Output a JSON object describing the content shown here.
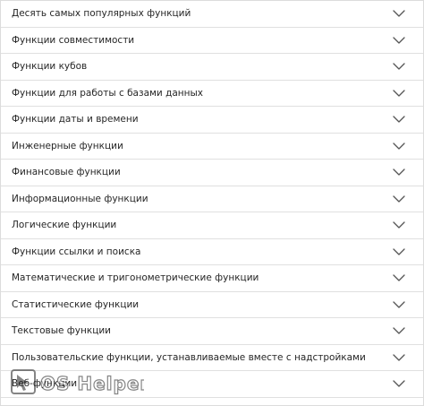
{
  "accordion": {
    "items": [
      {
        "label": "Десять самых популярных функций"
      },
      {
        "label": "Функции совместимости"
      },
      {
        "label": "Функции кубов"
      },
      {
        "label": "Функции для работы с базами данных"
      },
      {
        "label": "Функции даты и времени"
      },
      {
        "label": "Инженерные функции"
      },
      {
        "label": "Финансовые функции"
      },
      {
        "label": "Информационные функции"
      },
      {
        "label": "Логические функции"
      },
      {
        "label": "Функции ссылки и поиска"
      },
      {
        "label": "Математические и тригонометрические функции"
      },
      {
        "label": "Статистические функции"
      },
      {
        "label": "Текстовые функции"
      },
      {
        "label": "Пользовательские функции, устанавливаемые вместе с надстройками"
      },
      {
        "label": "Веб-функции"
      }
    ],
    "expand_icon": "chevron-down-icon"
  },
  "watermark": {
    "text": "OS Helper",
    "icon": "cursor-arrow-icon"
  },
  "colors": {
    "text": "#262626",
    "divider": "#e0e0e0",
    "chevron": "#555555",
    "background": "#ffffff"
  }
}
